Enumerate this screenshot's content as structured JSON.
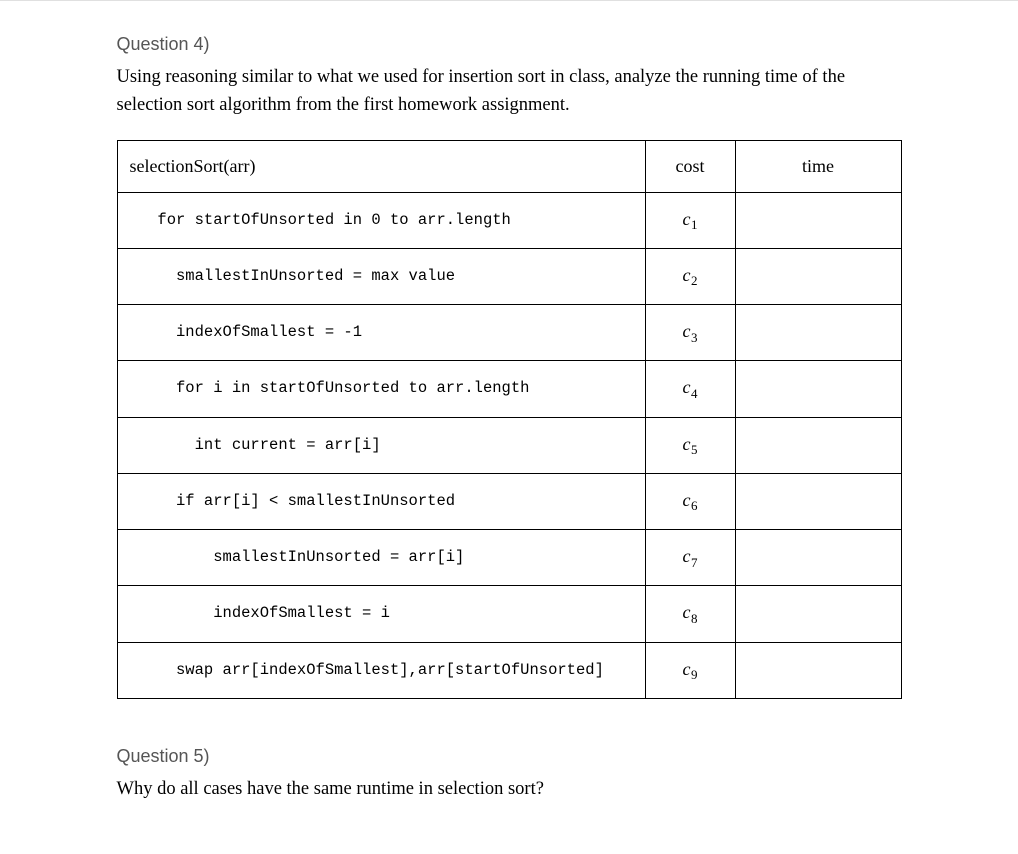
{
  "question4": {
    "label": "Question 4)",
    "text": "Using reasoning similar to what we used for insertion sort in class, analyze the running time of the selection sort algorithm from the first homework assignment."
  },
  "table": {
    "headers": {
      "algorithm": "selectionSort(arr)",
      "cost": "cost",
      "time": "time"
    },
    "rows": [
      {
        "code": "   for startOfUnsorted in 0 to arr.length",
        "cost_var": "c",
        "cost_sub": "1",
        "time": ""
      },
      {
        "code": "     smallestInUnsorted = max value",
        "cost_var": "c",
        "cost_sub": "2",
        "time": ""
      },
      {
        "code": "     indexOfSmallest = -1",
        "cost_var": "c",
        "cost_sub": "3",
        "time": ""
      },
      {
        "code": "     for i in startOfUnsorted to arr.length",
        "cost_var": "c",
        "cost_sub": "4",
        "time": ""
      },
      {
        "code": "       int current = arr[i]",
        "cost_var": "c",
        "cost_sub": "5",
        "time": ""
      },
      {
        "code": "     if arr[i] < smallestInUnsorted",
        "cost_var": "c",
        "cost_sub": "6",
        "time": ""
      },
      {
        "code": "         smallestInUnsorted = arr[i]",
        "cost_var": "c",
        "cost_sub": "7",
        "time": ""
      },
      {
        "code": "         indexOfSmallest = i",
        "cost_var": "c",
        "cost_sub": "8",
        "time": ""
      },
      {
        "code": "     swap arr[indexOfSmallest],arr[startOfUnsorted]",
        "cost_var": "c",
        "cost_sub": "9",
        "time": ""
      }
    ]
  },
  "question5": {
    "label": "Question 5)",
    "text": "Why do all cases have the same runtime in selection sort?"
  }
}
